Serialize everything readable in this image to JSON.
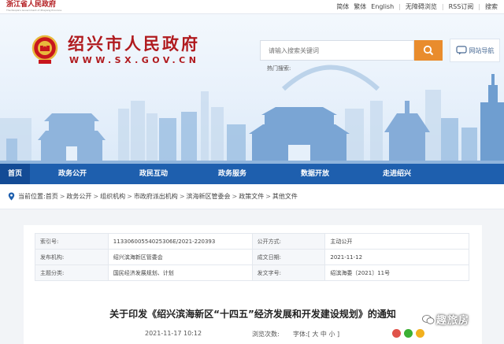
{
  "topbar": {
    "portal_name": "浙江省人民政府",
    "portal_subtitle": "The People's Government of Zhejiang Province",
    "links": [
      "简体",
      "繁体",
      "English",
      "无障碍浏览",
      "RSS订阅",
      "搜索"
    ]
  },
  "header": {
    "site_name": "绍兴市人民政府",
    "site_url": "WWW.SX.GOV.CN",
    "search_placeholder": "请输入搜索关键词",
    "hot_search_label": "热门搜索:",
    "message_label": "网站导航",
    "emblem_icon": "national-emblem-icon"
  },
  "nav": {
    "items": [
      "首页",
      "政务公开",
      "政民互动",
      "政务服务",
      "数据开放",
      "走进绍兴"
    ],
    "active_index": 0
  },
  "breadcrumb": {
    "label": "当前位置:",
    "items": [
      "首页",
      "政务公开",
      "组织机构",
      "市政府派出机构",
      "滨海新区管委会",
      "政策文件",
      "其他文件"
    ]
  },
  "meta": {
    "rows": [
      [
        {
          "k": "索引号:",
          "v": "11330600554025306E/2021-220393"
        },
        {
          "k": "公开方式:",
          "v": "主动公开"
        }
      ],
      [
        {
          "k": "发布机构:",
          "v": "绍兴滨海新区管委会"
        },
        {
          "k": "成文日期:",
          "v": "2021-11-12"
        }
      ],
      [
        {
          "k": "主题分类:",
          "v": "国民经济发展规划、计划"
        },
        {
          "k": "发文字号:",
          "v": "绍滨海委〔2021〕11号"
        }
      ]
    ]
  },
  "document": {
    "title": "关于印发《绍兴滨海新区“十四五”经济发展和开发建设规划》的通知",
    "date": "2021-11-17 10:12",
    "views_label": "浏览次数:",
    "font_size_label": "字体:[ 大 中 小 ]"
  },
  "watermark": {
    "text": "趣旅房"
  },
  "colors": {
    "brand_red": "#b01a1e",
    "nav_blue": "#1e5fae",
    "nav_active": "#134b95",
    "search_orange": "#e98c2d"
  }
}
